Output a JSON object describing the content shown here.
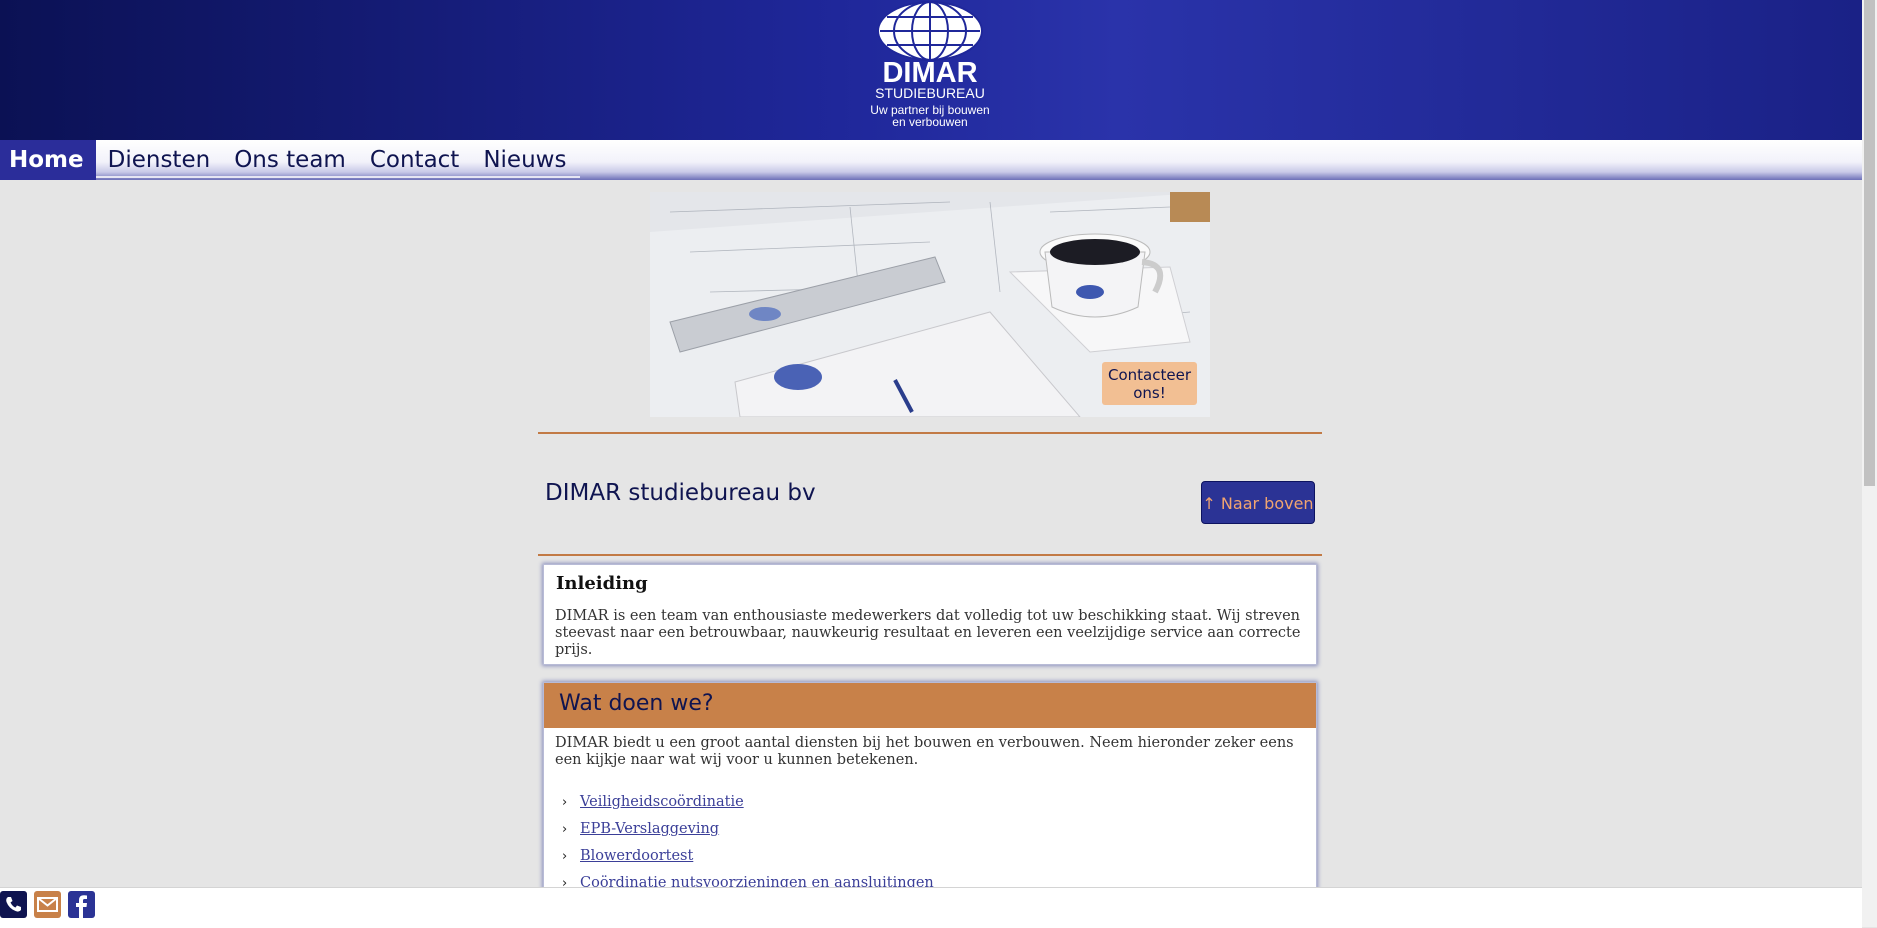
{
  "header": {
    "brand": "DIMAR",
    "sub": "STUDIEBUREAU",
    "tagline_line1": "Uw partner bij bouwen",
    "tagline_line2": "en verbouwen"
  },
  "nav": {
    "items": [
      {
        "label": "Home",
        "active": true
      },
      {
        "label": "Diensten"
      },
      {
        "label": "Ons team"
      },
      {
        "label": "Contact"
      },
      {
        "label": "Nieuws"
      }
    ]
  },
  "hero": {
    "cta_label": "Contacteer ons!"
  },
  "main": {
    "title": "DIMAR studiebureau bv",
    "back_to_top": "↑ Naar boven",
    "intro": {
      "heading": "Inleiding",
      "text": "DIMAR is een team van enthousiaste medewerkers dat volledig tot uw beschikking staat. Wij streven steevast naar een betrouwbaar, nauwkeurig resultaat en leveren een veelzijdige service aan correcte prijs."
    },
    "services": {
      "heading": "Wat doen we?",
      "text": "DIMAR biedt u een groot aantal diensten bij het bouwen en verbouwen. Neem hieronder zeker eens een kijkje naar wat wij voor u kunnen betekenen.",
      "links": [
        "Veiligheidscoördinatie",
        "EPB-Verslaggeving",
        "Blowerdoortest",
        "Coördinatie nutsvoorzieningen en aansluitingen"
      ]
    }
  },
  "footer": {
    "icons": [
      "phone-icon",
      "mail-icon",
      "facebook-icon"
    ]
  },
  "colors": {
    "header_dark": "#0b1154",
    "header_mid": "#2a33aa",
    "accent_orange": "#c88149",
    "nav_active": "#2b2d9a"
  }
}
